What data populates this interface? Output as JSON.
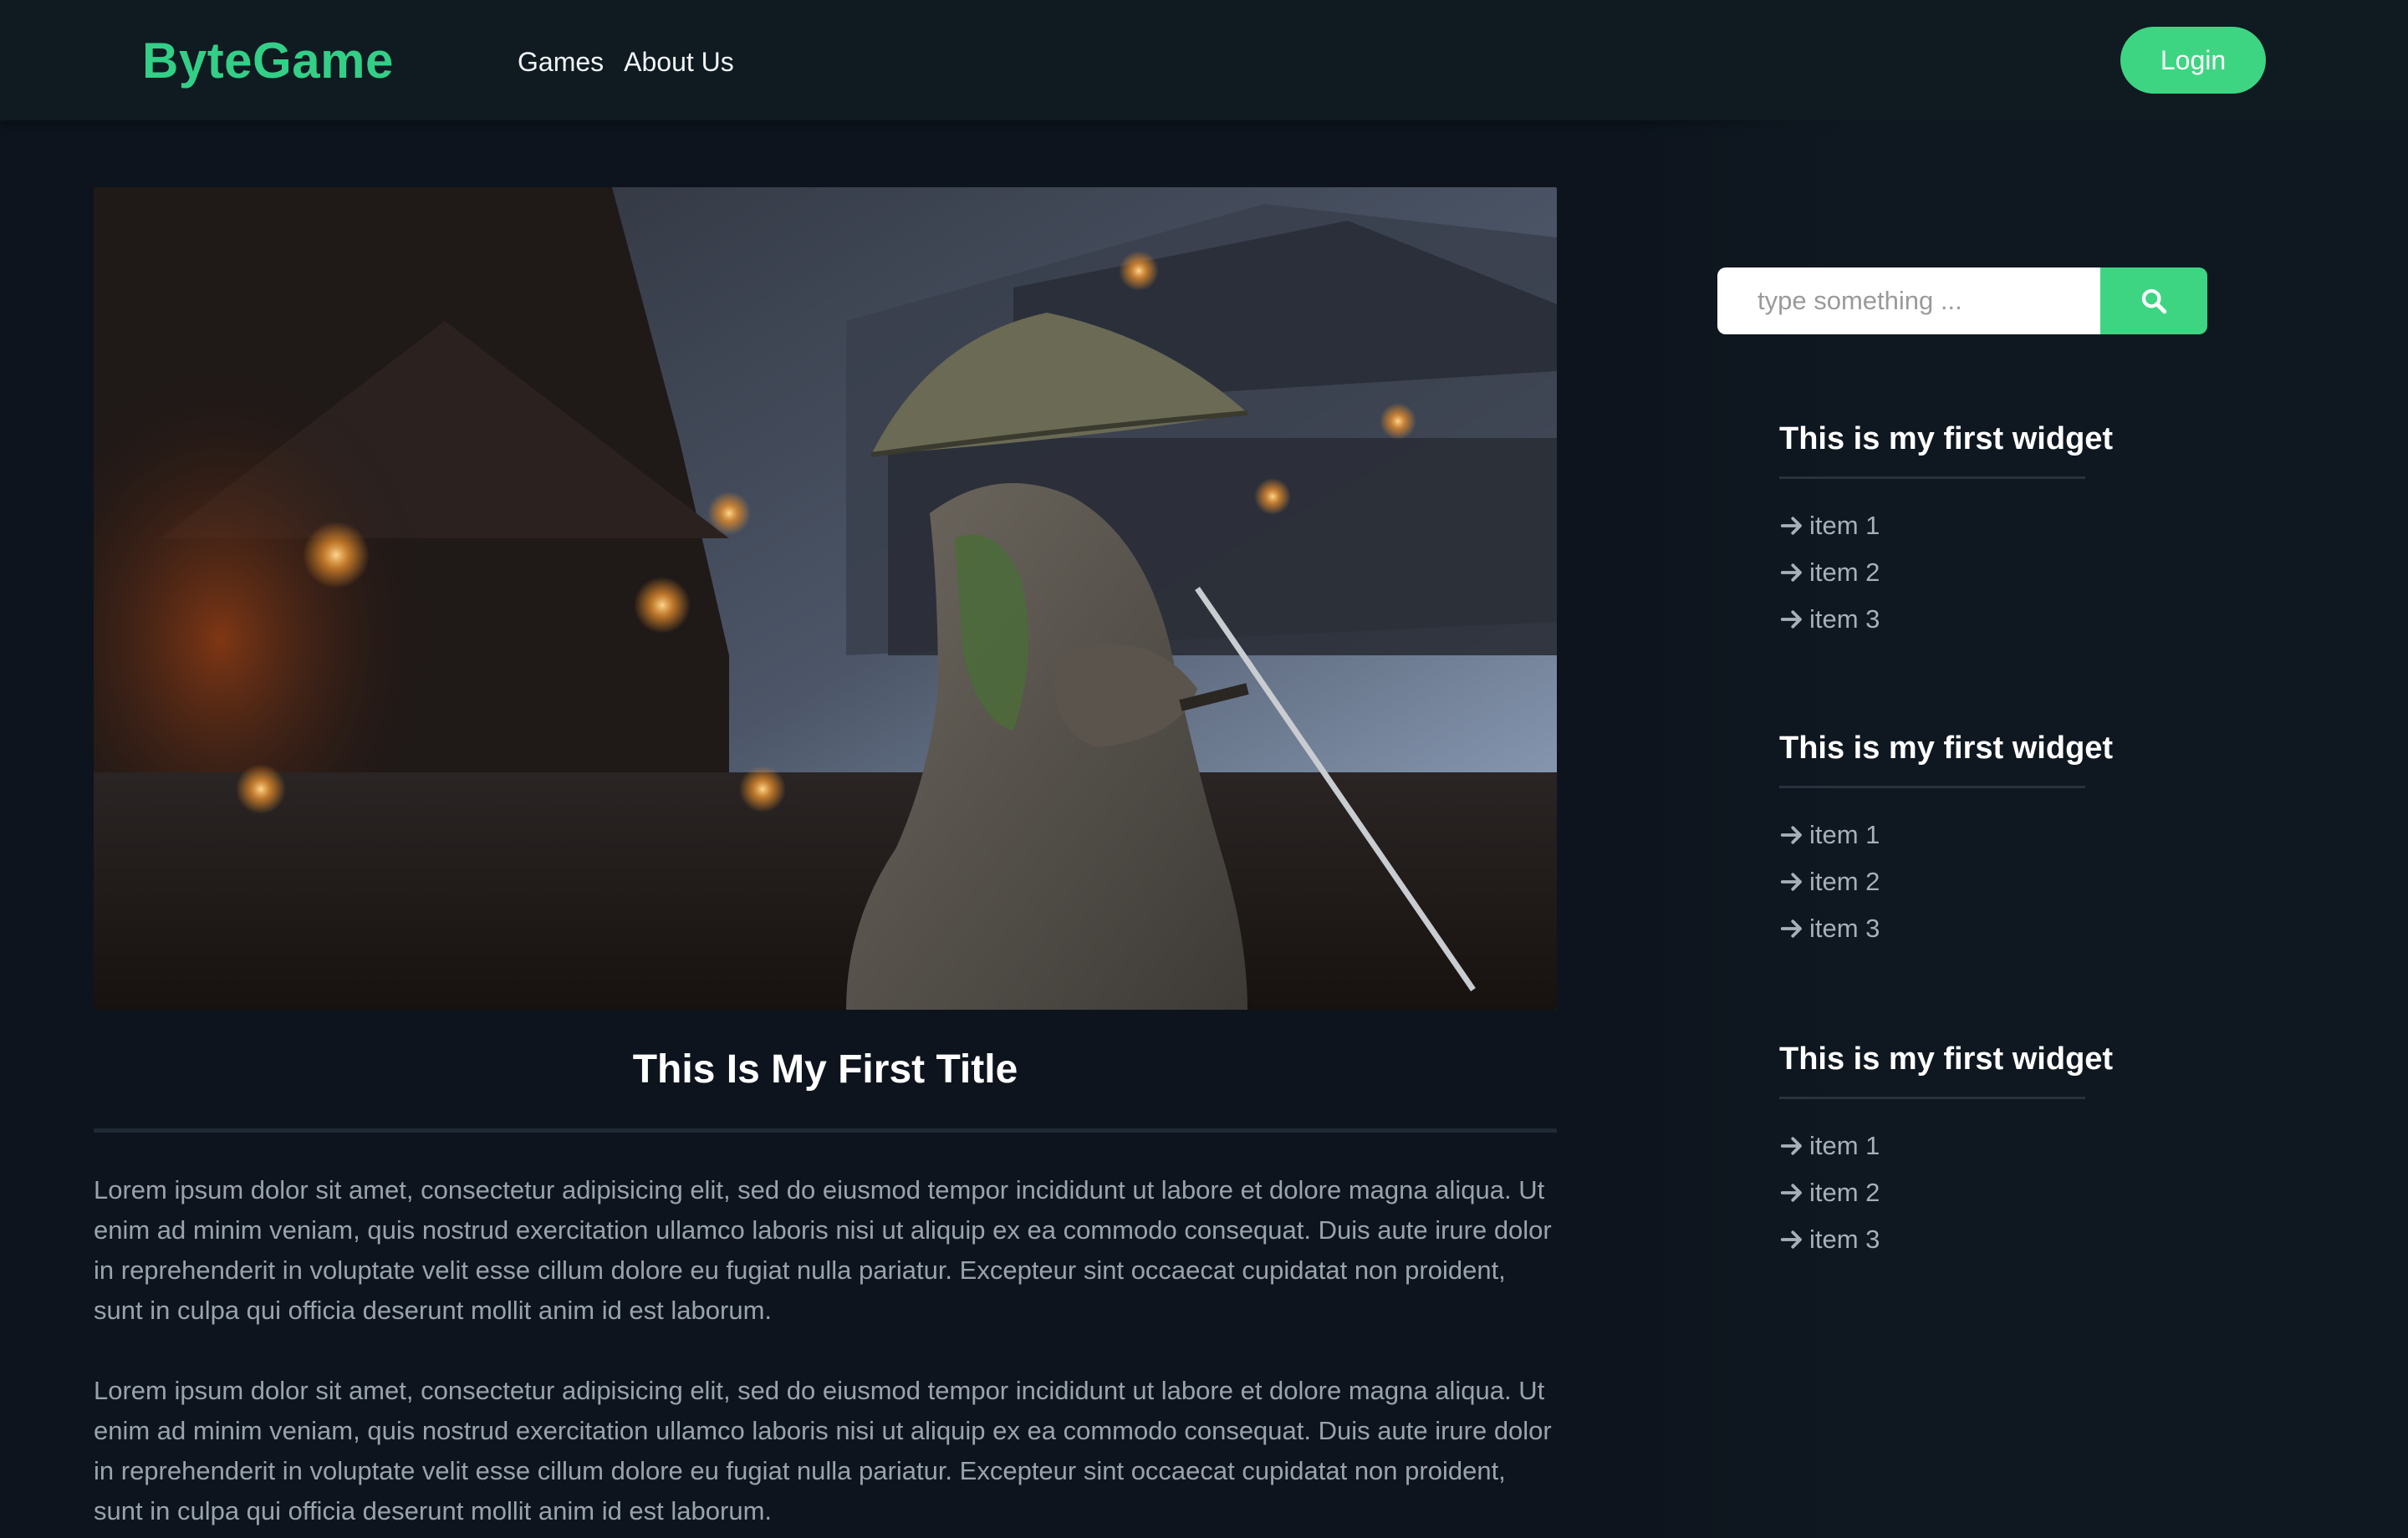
{
  "header": {
    "brand": "ByteGame",
    "nav": [
      {
        "label": "Games"
      },
      {
        "label": "About Us"
      }
    ],
    "login_label": "Login"
  },
  "article": {
    "title": "This Is My First Title",
    "paragraphs": [
      "Lorem ipsum dolor sit amet, consectetur adipisicing elit, sed do eiusmod tempor incididunt ut labore et dolore magna aliqua. Ut enim ad minim veniam, quis nostrud exercitation ullamco laboris nisi ut aliquip ex ea commodo consequat. Duis aute irure dolor in reprehenderit in voluptate velit esse cillum dolore eu fugiat nulla pariatur. Excepteur sint occaecat cupidatat non proident, sunt in culpa qui officia deserunt mollit anim id est laborum.",
      "Lorem ipsum dolor sit amet, consectetur adipisicing elit, sed do eiusmod tempor incididunt ut labore et dolore magna aliqua. Ut enim ad minim veniam, quis nostrud exercitation ullamco laboris nisi ut aliquip ex ea commodo consequat. Duis aute irure dolor in reprehenderit in voluptate velit esse cillum dolore eu fugiat nulla pariatur. Excepteur sint occaecat cupidatat non proident, sunt in culpa qui officia deserunt mollit anim id est laborum."
    ]
  },
  "search": {
    "placeholder": "type something ...",
    "button_icon": "search-icon"
  },
  "widgets": [
    {
      "title": "This is my first widget",
      "items": [
        "item 1",
        "item 2",
        "item 3"
      ]
    },
    {
      "title": "This is my first widget",
      "items": [
        "item 1",
        "item 2",
        "item 3"
      ]
    },
    {
      "title": "This is my first widget",
      "items": [
        "item 1",
        "item 2",
        "item 3"
      ]
    }
  ],
  "colors": {
    "accent": "#3ed582",
    "brand": "#33cf87",
    "background": "#0d141d",
    "header": "#0f1a21"
  }
}
